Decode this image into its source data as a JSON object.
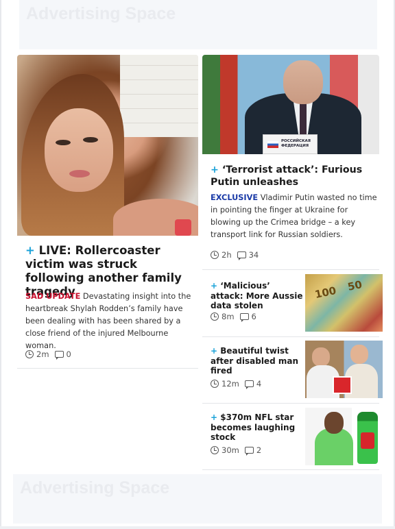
{
  "ads": {
    "top_label": "Advertising Space",
    "bottom_label": "Advertising Space"
  },
  "main_story": {
    "plus": "+",
    "headline": "LIVE: Rollercoaster victim was struck following another family tragedy",
    "tag": "SAD UPDATE",
    "summary": "Devastating insight into the heartbreak Shylah Rodden’s family have been dealing with has been shared by a close friend of the injured Melbourne woman.",
    "time": "2m",
    "comments": "0"
  },
  "story_two": {
    "plus": "+",
    "headline": "‘Terrorist attack’: Furious Putin unleashes",
    "tag": "EXCLUSIVE",
    "summary": "Vladimir Putin wasted no time in pointing the finger at Ukraine for blowing up the Crimea bridge – a key transport link for Russian soldiers.",
    "time": "2h",
    "comments": "34",
    "podium_text": "РОССИЙСКАЯ ФЕДЕРАЦИЯ"
  },
  "small_stories": [
    {
      "plus": "+",
      "headline": "‘Malicious’ attack: More Aussie data stolen",
      "time": "8m",
      "comments": "6",
      "thumb": "banknotes"
    },
    {
      "plus": "+",
      "headline": "Beautiful twist after disabled man fired",
      "time": "12m",
      "comments": "4",
      "thumb": "two-men"
    },
    {
      "plus": "+",
      "headline": "$370m NFL star becomes laughing stock",
      "time": "30m",
      "comments": "2",
      "thumb": "nfl-star-soda"
    }
  ],
  "icons": {
    "clock": "clock-icon",
    "comment": "comment-icon",
    "plus_color": "#1aa2d8",
    "tag_red": "#c8102e",
    "tag_blue": "#1a3aa7"
  }
}
